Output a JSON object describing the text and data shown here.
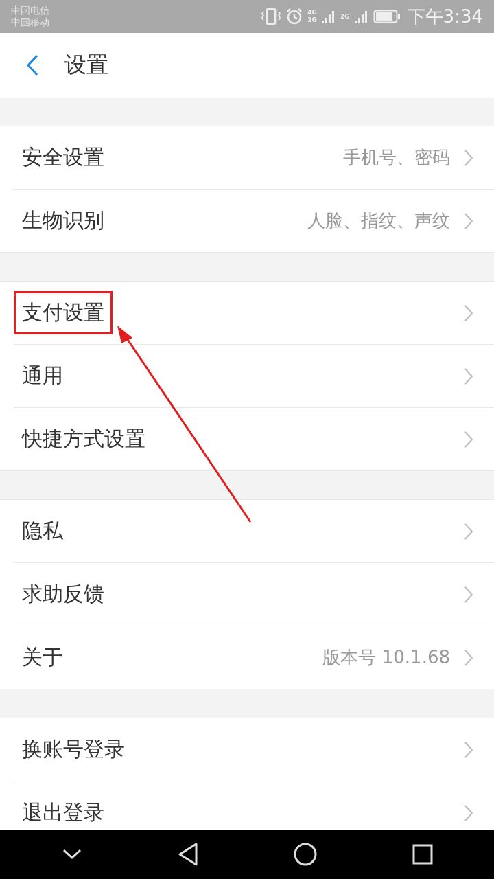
{
  "status_bar": {
    "carriers": [
      "中国电信",
      "中国移动"
    ],
    "time": "下午3:34",
    "network_1": "4G",
    "network_2": "2G",
    "network_3": "2G"
  },
  "header": {
    "title": "设置"
  },
  "groups": [
    {
      "items": [
        {
          "label": "安全设置",
          "value": "手机号、密码"
        },
        {
          "label": "生物识别",
          "value": "人脸、指纹、声纹"
        }
      ]
    },
    {
      "items": [
        {
          "label": "支付设置",
          "highlighted": true
        },
        {
          "label": "通用"
        },
        {
          "label": "快捷方式设置"
        }
      ]
    },
    {
      "items": [
        {
          "label": "隐私"
        },
        {
          "label": "求助反馈"
        },
        {
          "label": "关于",
          "value": "版本号 10.1.68"
        }
      ]
    },
    {
      "items": [
        {
          "label": "换账号登录"
        },
        {
          "label": "退出登录"
        }
      ]
    }
  ]
}
